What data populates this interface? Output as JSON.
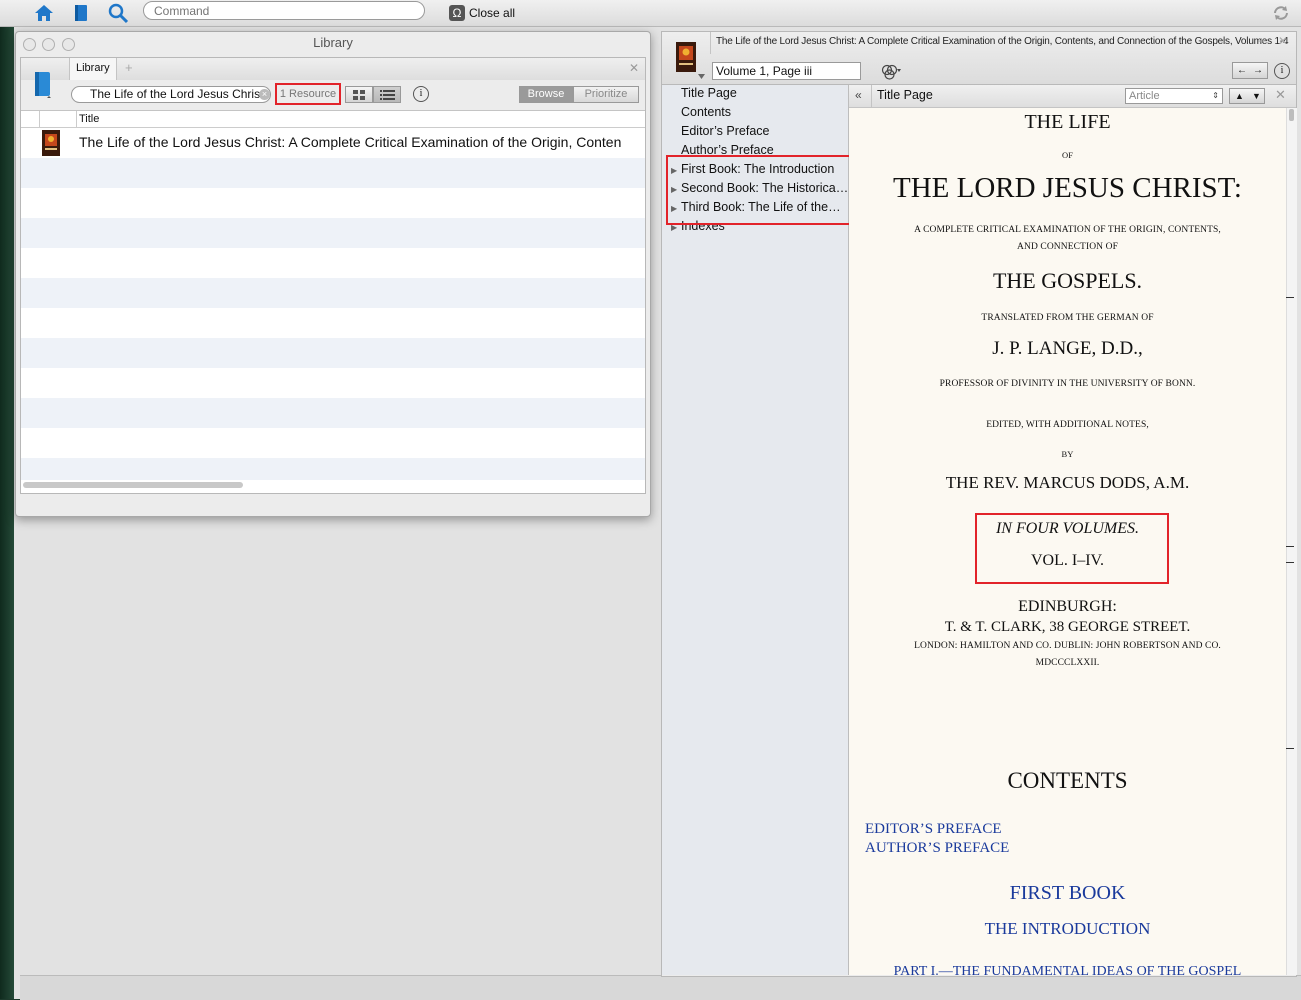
{
  "app_toolbar": {
    "command_placeholder": "Command",
    "close_all_label": "Close all"
  },
  "library": {
    "window_title": "Library",
    "tab_label": "Library",
    "search_value": "The Life of the Lord Jesus Chris",
    "resource_count": "1 Resource",
    "browse_label": "Browse",
    "prioritize_label": "Prioritize",
    "column_title": "Title",
    "rows": [
      {
        "title": "The Life of the Lord Jesus Christ: A Complete Critical Examination of the Origin, Conten"
      }
    ]
  },
  "reader": {
    "tab_title": "The Life of the Lord Jesus Christ: A Complete Critical Examination of the Origin, Contents, and Connection of the Gospels, Volumes 1-4",
    "reference": "Volume 1, Page iii",
    "page_title": "Title Page",
    "section_select": "Article",
    "toc": [
      {
        "label": "Title Page",
        "expandable": false
      },
      {
        "label": "Contents",
        "expandable": false
      },
      {
        "label": "Editor’s Preface",
        "expandable": false
      },
      {
        "label": "Author’s Preface",
        "expandable": false
      },
      {
        "label": "First Book: The Introduction",
        "expandable": true
      },
      {
        "label": "Second Book: The Historica…",
        "expandable": true
      },
      {
        "label": "Third Book: The Life of the…",
        "expandable": true
      },
      {
        "label": "Indexes",
        "expandable": true
      }
    ],
    "page": {
      "line1": "THE LIFE",
      "line2": "OF",
      "line3": "THE LORD JESUS CHRIST:",
      "line4": "A COMPLETE CRITICAL EXAMINATION OF THE ORIGIN, CONTENTS,",
      "line5": "AND CONNECTION OF",
      "line6": "THE GOSPELS.",
      "line7": "TRANSLATED FROM THE GERMAN OF",
      "line8": "J. P. LANGE, D.D.,",
      "line9": "PROFESSOR OF DIVINITY IN THE UNIVERSITY OF BONN.",
      "line10": "EDITED, WITH ADDITIONAL NOTES,",
      "line11": "BY",
      "line12": "THE REV. MARCUS DODS, A.M.",
      "line13": "IN FOUR VOLUMES.",
      "line14": "VOL. I–IV.",
      "line15": "EDINBURGH:",
      "line16": "T. & T. CLARK, 38 GEORGE STREET.",
      "line17": "LONDON: HAMILTON AND CO. DUBLIN: JOHN ROBERTSON AND CO.",
      "line18": "MDCCCLXXII.",
      "contents_heading": "CONTENTS",
      "link1": "EDITOR’S PREFACE",
      "link2": "AUTHOR’S PREFACE",
      "link3": "FIRST BOOK",
      "link4": "THE INTRODUCTION",
      "link5": "PART I.—THE FUNDAMENTAL IDEAS OF THE GOSPEL"
    }
  },
  "colors": {
    "highlight_red": "#e2232a",
    "link_blue": "#1a3a9c",
    "toolbar_icon_blue": "#1f77c9"
  }
}
